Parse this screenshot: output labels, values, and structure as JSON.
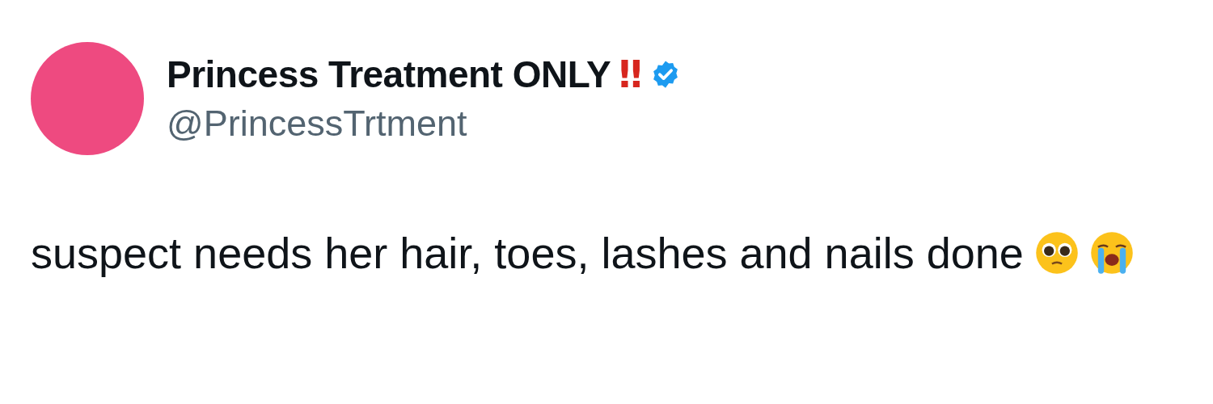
{
  "author": {
    "name": "Princess Treatment ONLY",
    "name_mark": "‼",
    "verified": true,
    "handle": "@PrincessTrtment"
  },
  "tweet": {
    "text": "suspect needs her hair, toes, lashes and nails done",
    "emojis": [
      {
        "kind": "pleading"
      },
      {
        "kind": "crying"
      }
    ]
  }
}
